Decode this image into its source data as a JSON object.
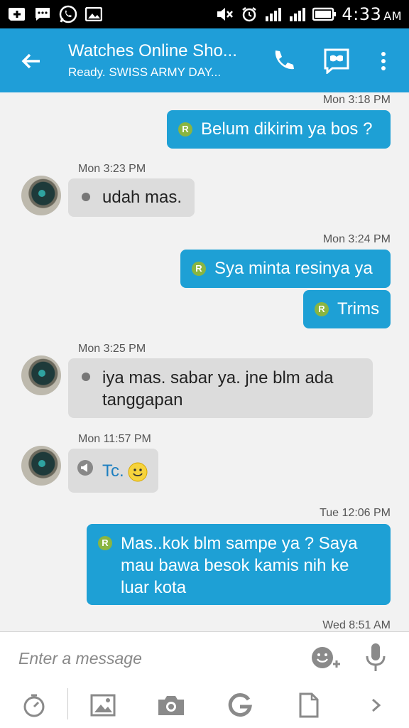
{
  "status_bar": {
    "time": "4:33",
    "ampm": "AM",
    "icons": [
      "add-message-icon",
      "sms-icon",
      "whatsapp-icon",
      "gallery-icon",
      "mute-icon",
      "alarm-icon",
      "signal-1-icon",
      "signal-2-icon",
      "battery-icon"
    ]
  },
  "header": {
    "title": "Watches Online Sho...",
    "subtitle": "Ready. SWISS ARMY DAY...",
    "accent": "#1f9ed8"
  },
  "messages": [
    {
      "time": "Mon 3:18 PM",
      "direction": "out",
      "text": "Belum dikirim ya bos ?"
    },
    {
      "time": "Mon 3:23 PM",
      "direction": "in",
      "text": "udah mas."
    },
    {
      "time": "Mon 3:24 PM",
      "direction": "out",
      "text": "Sya minta resinya ya"
    },
    {
      "time": "",
      "direction": "out",
      "text": "Trims"
    },
    {
      "time": "Mon 3:25 PM",
      "direction": "in",
      "text": "iya mas. sabar ya. jne blm ada tanggapan"
    },
    {
      "time": "Mon 11:57 PM",
      "direction": "in",
      "text": "Tc."
    },
    {
      "time": "Tue 12:06 PM",
      "direction": "out",
      "text": "Mas..kok blm sampe ya ? Saya mau bawa besok kamis nih ke luar kota"
    },
    {
      "time": "Wed 8:51 AM",
      "direction": "out",
      "text": ""
    }
  ],
  "badge_letter": "R",
  "composer": {
    "placeholder": "Enter a message"
  },
  "colors": {
    "outgoing_bubble": "#1ea0d5",
    "incoming_bubble": "#dcdcdc",
    "read_badge": "#8ab541"
  }
}
